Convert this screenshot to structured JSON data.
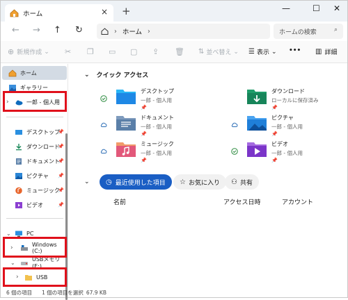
{
  "window": {
    "tab_label": "ホーム",
    "close_tab": "×",
    "new_tab": "+",
    "minimize": "—",
    "maximize": "☐",
    "close": "✕"
  },
  "address": {
    "path_label": "ホーム",
    "search_placeholder": "ホームの検索"
  },
  "toolbar": {
    "new": "新規作成",
    "sort": "並べ替え",
    "view": "表示",
    "more": "•••",
    "details": "詳細"
  },
  "sidebar": {
    "home": "ホーム",
    "gallery": "ギャラリー",
    "onedrive": "一郎 - 個人用",
    "desktop": "デスクトップ",
    "downloads": "ダウンロード",
    "documents": "ドキュメント",
    "pictures": "ピクチャ",
    "music": "ミュージック",
    "videos": "ビデオ",
    "pc": "PC",
    "windows_c": "Windows (C:)",
    "usb_drive": "USBメモリ (E:)",
    "usb_folder": "USB"
  },
  "main": {
    "quick_access": "クイック アクセス",
    "cards": [
      {
        "name": "デスクトップ",
        "sub": "一郎 - 個人用"
      },
      {
        "name": "ダウンロード",
        "sub": "ローカルに保存済み"
      },
      {
        "name": "ドキュメント",
        "sub": "一郎 - 個人用"
      },
      {
        "name": "ピクチャ",
        "sub": "一郎 - 個人用"
      },
      {
        "name": "ミュージック",
        "sub": "一郎 - 個人用"
      },
      {
        "name": "ビデオ",
        "sub": "一郎 - 個人用"
      }
    ],
    "pills": {
      "recent": "最近使用した項目",
      "favorites": "お気に入り",
      "shared": "共有"
    },
    "columns": {
      "name": "名前",
      "date": "アクセス日時",
      "account": "アカウント"
    }
  },
  "status": {
    "items": "6 個の項目",
    "selected": "1 個の項目を選択",
    "size": "67.9 KB"
  },
  "colors": {
    "accent": "#1a5ec4",
    "highlight": "#e0101b",
    "selected_bg": "#d3dbe4"
  }
}
